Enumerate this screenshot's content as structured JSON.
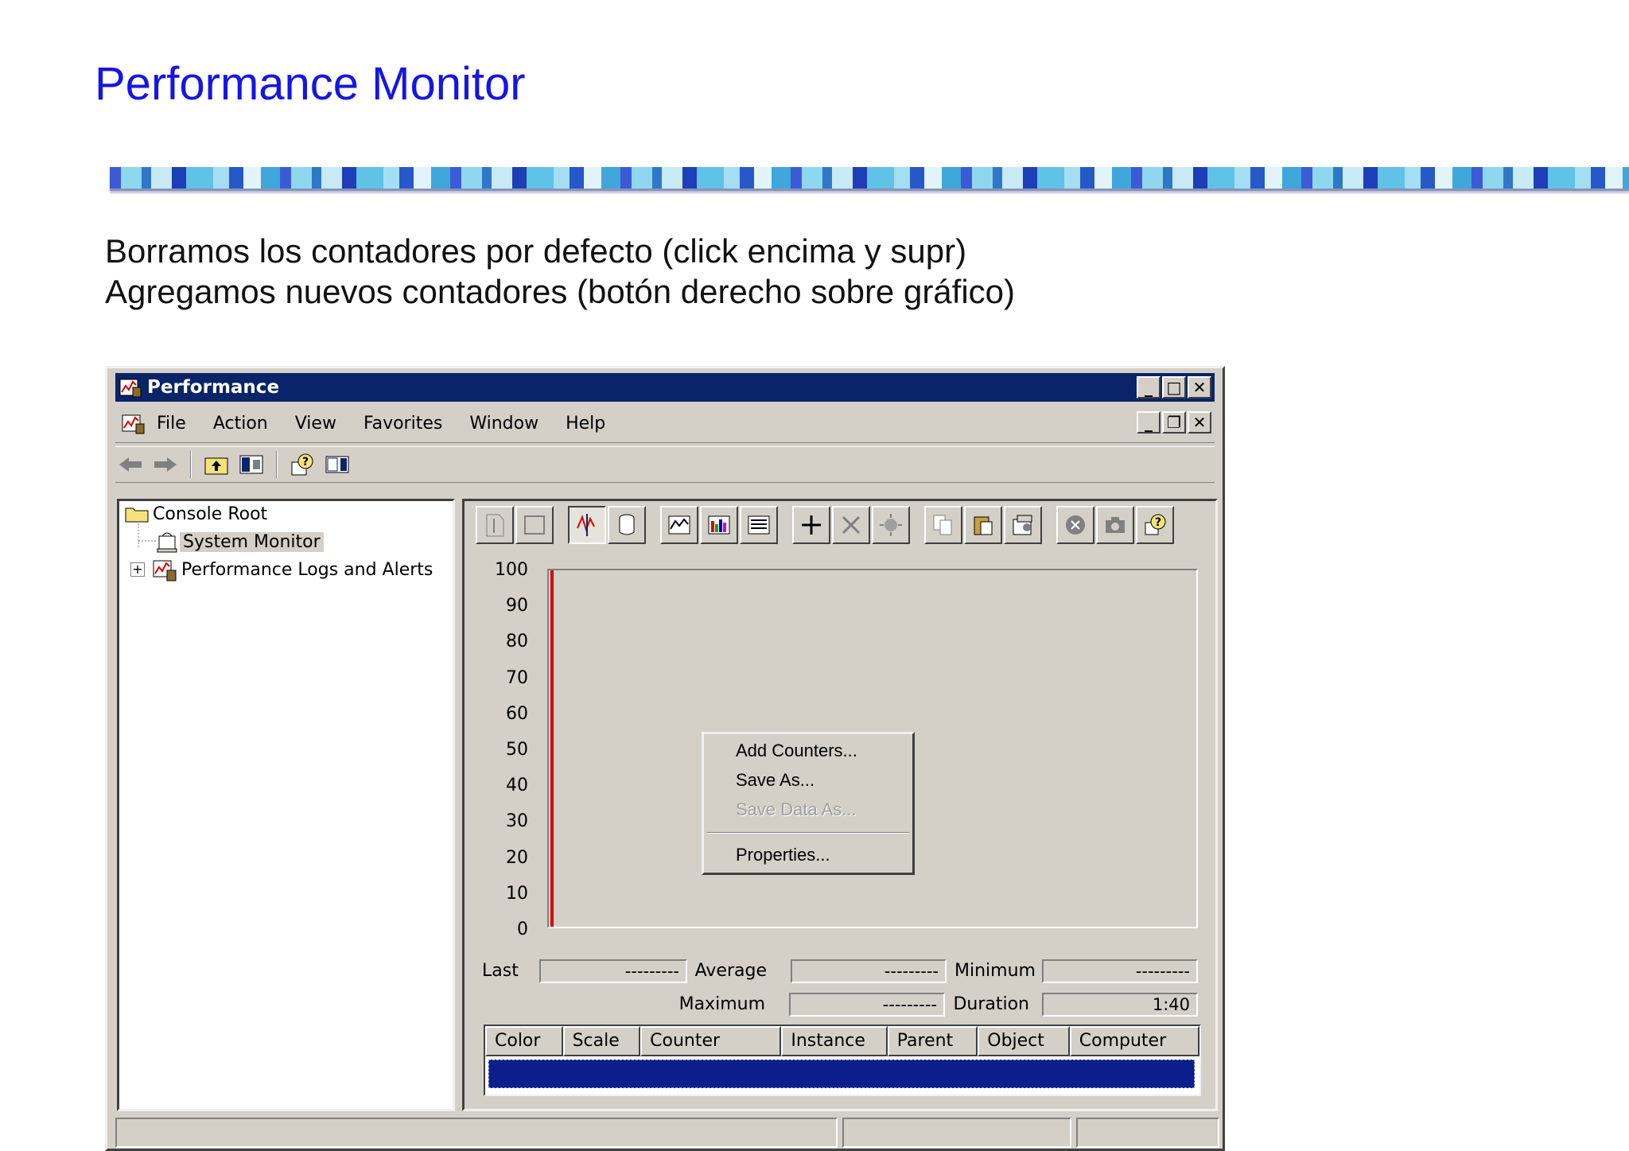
{
  "slide": {
    "title": "Performance Monitor",
    "lines": [
      "Borramos los contadores por defecto (click encima y supr)",
      "Agregamos nuevos contadores (botón derecho sobre gráfico)"
    ]
  },
  "window": {
    "title": "Performance",
    "caption_buttons": {
      "minimize": "_",
      "maximize": "□",
      "close": "✕"
    },
    "mdi_buttons": {
      "minimize": "_",
      "restore": "❐",
      "close": "✕"
    },
    "menu": [
      "File",
      "Action",
      "View",
      "Favorites",
      "Window",
      "Help"
    ],
    "menu_accel": [
      "F",
      "A",
      "V",
      "o",
      "W",
      "H"
    ]
  },
  "tree": {
    "root": "Console Root",
    "items": [
      "System Monitor",
      "Performance Logs and Alerts"
    ],
    "expander": "+"
  },
  "graph": {
    "y_ticks": [
      "100",
      "90",
      "80",
      "70",
      "60",
      "50",
      "40",
      "30",
      "20",
      "10",
      "0"
    ],
    "colors": {
      "time_bar": "#e00000",
      "background": "#d4d0c8"
    }
  },
  "context_menu": {
    "items": [
      "Add Counters...",
      "Save As...",
      "Save Data As...",
      "Properties..."
    ],
    "disabled": [
      "Save Data As..."
    ]
  },
  "stats": {
    "last_label": "Last",
    "last_value": "---------",
    "average_label": "Average",
    "average_value": "---------",
    "minimum_label": "Minimum",
    "minimum_value": "---------",
    "maximum_label": "Maximum",
    "maximum_value": "---------",
    "duration_label": "Duration",
    "duration_value": "1:40"
  },
  "legend": {
    "columns": [
      "Color",
      "Scale",
      "Counter",
      "Instance",
      "Parent",
      "Object",
      "Computer"
    ]
  },
  "icons": {
    "back": "arrow-left-icon",
    "forward": "arrow-right-icon",
    "up": "up-folder-icon",
    "show_tree": "show-tree-icon",
    "help": "help-icon",
    "show_pane": "show-pane-icon"
  }
}
